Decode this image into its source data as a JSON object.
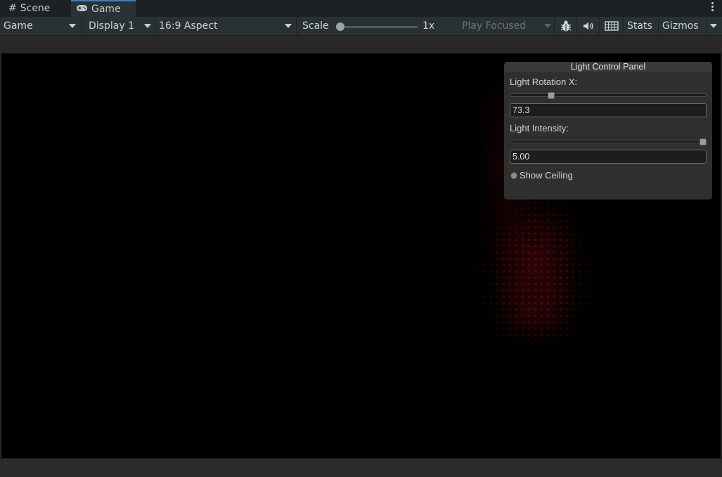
{
  "tabs": [
    {
      "label": "Scene",
      "icon": "hash-grid-icon"
    },
    {
      "label": "Game",
      "icon": "gamepad-icon"
    }
  ],
  "toolbar": {
    "view_mode": "Game",
    "display": "Display 1",
    "aspect": "16:9 Aspect",
    "scale_label": "Scale",
    "scale_value": "1x",
    "play_mode": "Play Focused",
    "stats_label": "Stats",
    "gizmos_label": "Gizmos",
    "icons": [
      "bug-icon",
      "speaker-icon",
      "keyboard-icon"
    ]
  },
  "panel": {
    "title": "Light Control Panel",
    "rotation_label": "Light Rotation X:",
    "rotation_value": "73.3",
    "rotation_fraction": 0.2,
    "intensity_label": "Light Intensity:",
    "intensity_value": "5.00",
    "intensity_fraction": 1.0,
    "ceiling_label": "Show Ceiling"
  },
  "colors": {
    "accent": "#3d7fc6",
    "toolbar": "#283235",
    "viewport": "#000000",
    "light_glow": "#8c1218"
  }
}
